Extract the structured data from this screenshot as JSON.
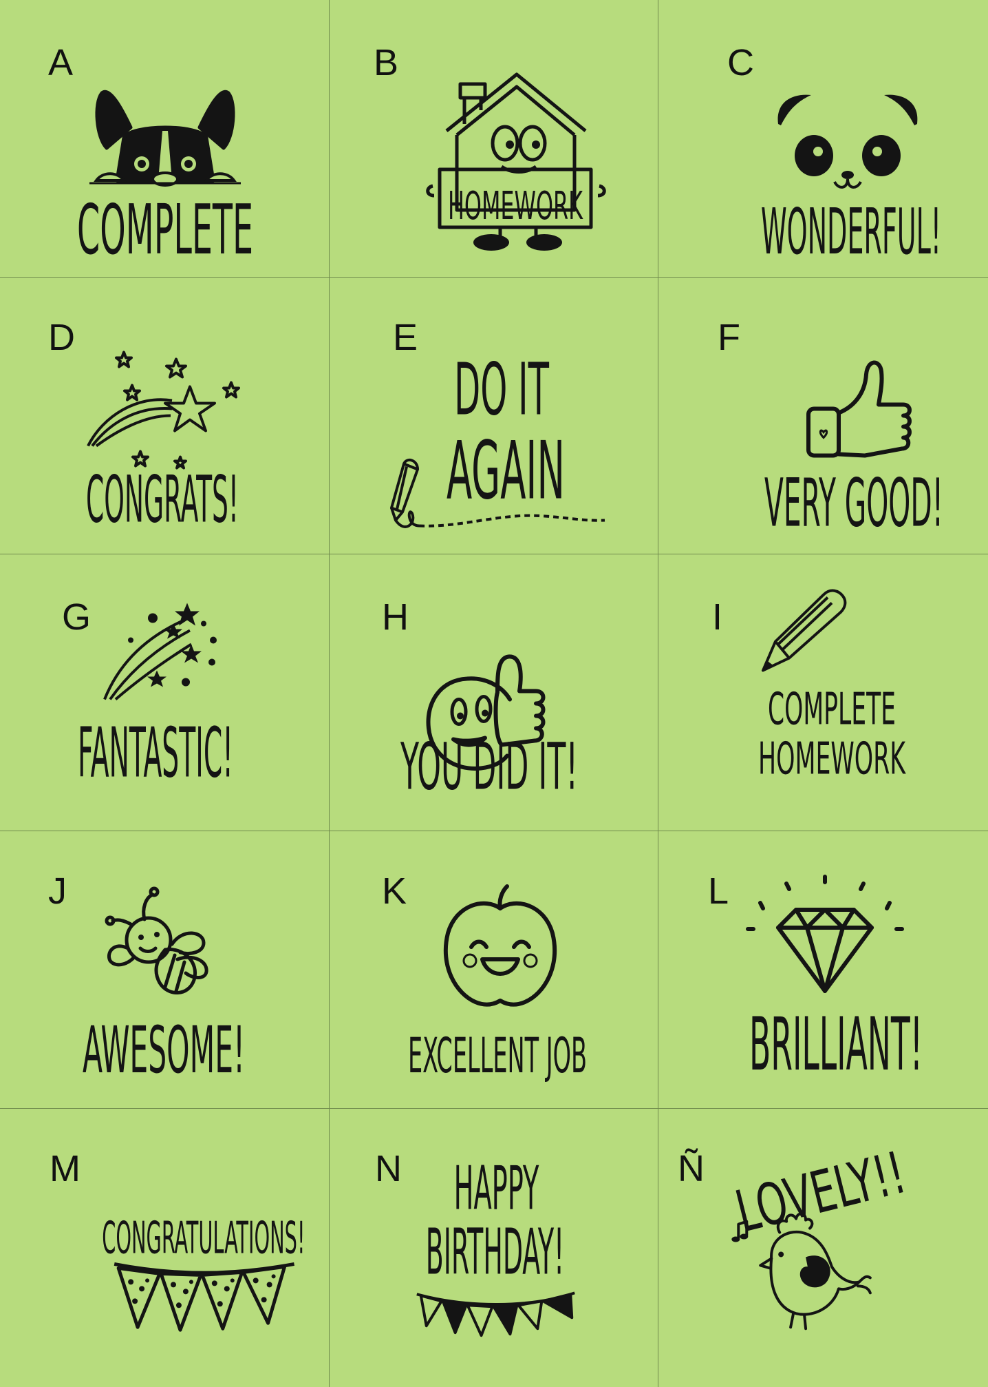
{
  "colors": {
    "background": "#b7dc7d",
    "ink": "#141414",
    "grid_line": "#6f8a4c"
  },
  "stamps": [
    {
      "letter": "A",
      "lines": [
        "COMPLETE"
      ],
      "icon": "french-bulldog-peeking-icon"
    },
    {
      "letter": "B",
      "lines": [
        "HOMEWORK"
      ],
      "icon": "house-character-icon"
    },
    {
      "letter": "C",
      "lines": [
        "WONDERFUL!"
      ],
      "icon": "panda-face-icon"
    },
    {
      "letter": "D",
      "lines": [
        "CONGRATS!"
      ],
      "icon": "shooting-star-icon"
    },
    {
      "letter": "E",
      "lines": [
        "DO IT",
        "AGAIN"
      ],
      "icon": "pencil-icon"
    },
    {
      "letter": "F",
      "lines": [
        "VERY GOOD!"
      ],
      "icon": "thumbs-up-icon"
    },
    {
      "letter": "G",
      "lines": [
        "FANTASTIC!"
      ],
      "icon": "fireworks-icon"
    },
    {
      "letter": "H",
      "lines": [
        "YOU DID IT!"
      ],
      "icon": "smiley-thumbs-up-icon"
    },
    {
      "letter": "I",
      "lines": [
        "COMPLETE",
        "HOMEWORK"
      ],
      "icon": "pencil-icon"
    },
    {
      "letter": "J",
      "lines": [
        "AWESOME!"
      ],
      "icon": "bee-icon"
    },
    {
      "letter": "K",
      "lines": [
        "EXCELLENT JOB"
      ],
      "icon": "apple-face-icon"
    },
    {
      "letter": "L",
      "lines": [
        "BRILLIANT!"
      ],
      "icon": "diamond-icon"
    },
    {
      "letter": "M",
      "lines": [
        "CONGRATULATIONS!"
      ],
      "icon": "bunting-flags-icon"
    },
    {
      "letter": "N",
      "lines": [
        "HAPPY",
        "BIRTHDAY!"
      ],
      "icon": "bunting-flags-icon"
    },
    {
      "letter": "Ñ",
      "lines": [
        "LOVELY!!"
      ],
      "icon": "bird-icon"
    }
  ]
}
